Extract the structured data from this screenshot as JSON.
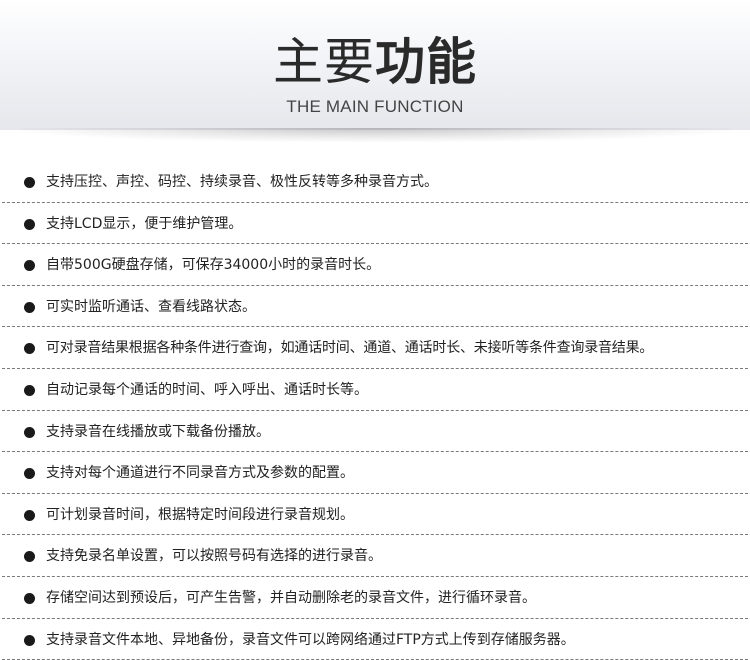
{
  "header": {
    "title_light": "主要",
    "title_bold": "功能",
    "subtitle": "THE MAIN FUNCTION"
  },
  "features": [
    "支持压控、声控、码控、持续录音、极性反转等多种录音方式。",
    "支持LCD显示，便于维护管理。",
    "自带500G硬盘存储，可保存34000小时的录音时长。",
    "可实时监听通话、查看线路状态。",
    "可对录音结果根据各种条件进行查询，如通话时间、通道、通话时长、未接听等条件查询录音结果。",
    "自动记录每个通话的时间、呼入呼出、通话时长等。",
    "支持录音在线播放或下载备份播放。",
    "支持对每个通道进行不同录音方式及参数的配置。",
    "可计划录音时间，根据特定时间段进行录音规划。",
    "支持免录名单设置，可以按照号码有选择的进行录音。",
    "存储空间达到预设后，可产生告警，并自动删除老的录音文件，进行循环录音。",
    "支持录音文件本地、异地备份，录音文件可以跨网络通过FTP方式上传到存储服务器。"
  ]
}
